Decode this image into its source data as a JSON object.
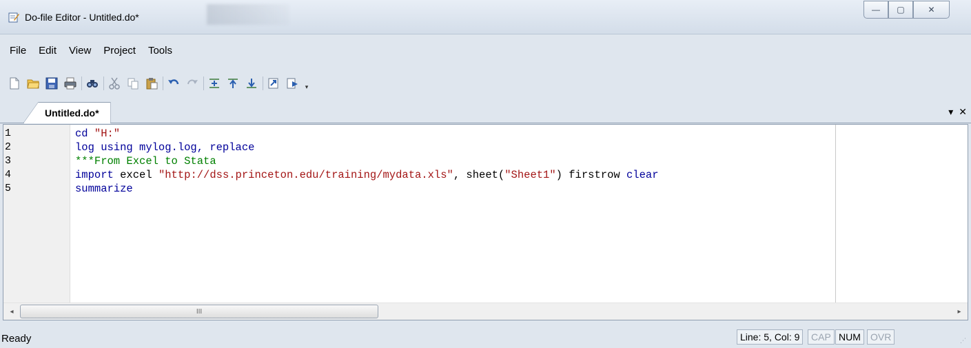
{
  "window": {
    "title": "Do-file Editor - Untitled.do*",
    "controls": {
      "minimize": "—",
      "maximize": "▢",
      "close": "✕"
    }
  },
  "menu": {
    "items": [
      "File",
      "Edit",
      "View",
      "Project",
      "Tools"
    ]
  },
  "toolbar": {
    "icons": [
      "new-file-icon",
      "open-folder-icon",
      "save-icon",
      "print-icon",
      "find-icon",
      "cut-icon",
      "copy-icon",
      "paste-icon",
      "undo-icon",
      "redo-icon",
      "shift-right-icon",
      "shift-left-icon",
      "format-icon",
      "execute-selection-icon",
      "do-icon"
    ],
    "more": "▾"
  },
  "tabs": {
    "active": "Untitled.do*",
    "dropdown": "▾",
    "close": "✕"
  },
  "editor": {
    "line_numbers": [
      "1",
      "2",
      "3",
      "4",
      "5"
    ],
    "lines": [
      {
        "segments": [
          {
            "t": "cd ",
            "c": "kw"
          },
          {
            "t": "\"H:\"",
            "c": "str"
          }
        ]
      },
      {
        "segments": [
          {
            "t": "log using mylog.log, replace",
            "c": "kw"
          }
        ]
      },
      {
        "segments": [
          {
            "t": "***From Excel to Stata",
            "c": "cmt"
          }
        ]
      },
      {
        "segments": [
          {
            "t": "import ",
            "c": "kw"
          },
          {
            "t": "excel ",
            "c": "txt"
          },
          {
            "t": "\"http://dss.princeton.edu/training/mydata.xls\"",
            "c": "str"
          },
          {
            "t": ", sheet(",
            "c": "txt"
          },
          {
            "t": "\"Sheet1\"",
            "c": "str"
          },
          {
            "t": ") firstrow ",
            "c": "txt"
          },
          {
            "t": "clear",
            "c": "kw"
          }
        ]
      },
      {
        "segments": [
          {
            "t": "summarize",
            "c": "kw"
          }
        ]
      }
    ],
    "scroll_left": "◂",
    "scroll_right": "▸",
    "scroll_thumb": "III"
  },
  "status": {
    "text": "Ready",
    "position": "Line: 5, Col: 9",
    "cap": "CAP",
    "num": "NUM",
    "ovr": "OVR"
  },
  "colors": {
    "keyword": "#00009a",
    "string": "#a31515",
    "comment": "#008000"
  }
}
